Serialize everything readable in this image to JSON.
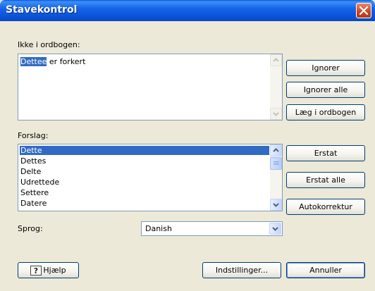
{
  "window": {
    "title": "Stavekontrol"
  },
  "not_in_dictionary": {
    "label": "Ikke i ordbogen:",
    "flagged_word": "Dettee",
    "rest_text": " er forkert"
  },
  "suggestions": {
    "label": "Forslag:",
    "items": [
      "Dette",
      "Dettes",
      "Delte",
      "Udrettede",
      "Settere",
      "Datere"
    ],
    "selected_index": 0
  },
  "language": {
    "label": "Sprog:",
    "value": "Danish"
  },
  "buttons": {
    "ignore": "Ignorer",
    "ignore_all": "Ignorer alle",
    "add_to_dictionary": "Læg i ordbogen",
    "replace": "Erstat",
    "replace_all": "Erstat alle",
    "autocorrect": "Autokorrektur",
    "help": "Hjælp",
    "options": "Indstillinger...",
    "cancel": "Annuller"
  },
  "icons": {
    "close": "close-icon",
    "help": "help-icon",
    "scroll_up": "scroll-up-arrow-icon",
    "scroll_down": "scroll-down-arrow-icon",
    "dropdown": "chevron-down-icon"
  },
  "colors": {
    "titlebar": "#0a51d6",
    "selection": "#316ac5",
    "dialog_bg": "#ece9d8",
    "close_button": "#c94424"
  }
}
